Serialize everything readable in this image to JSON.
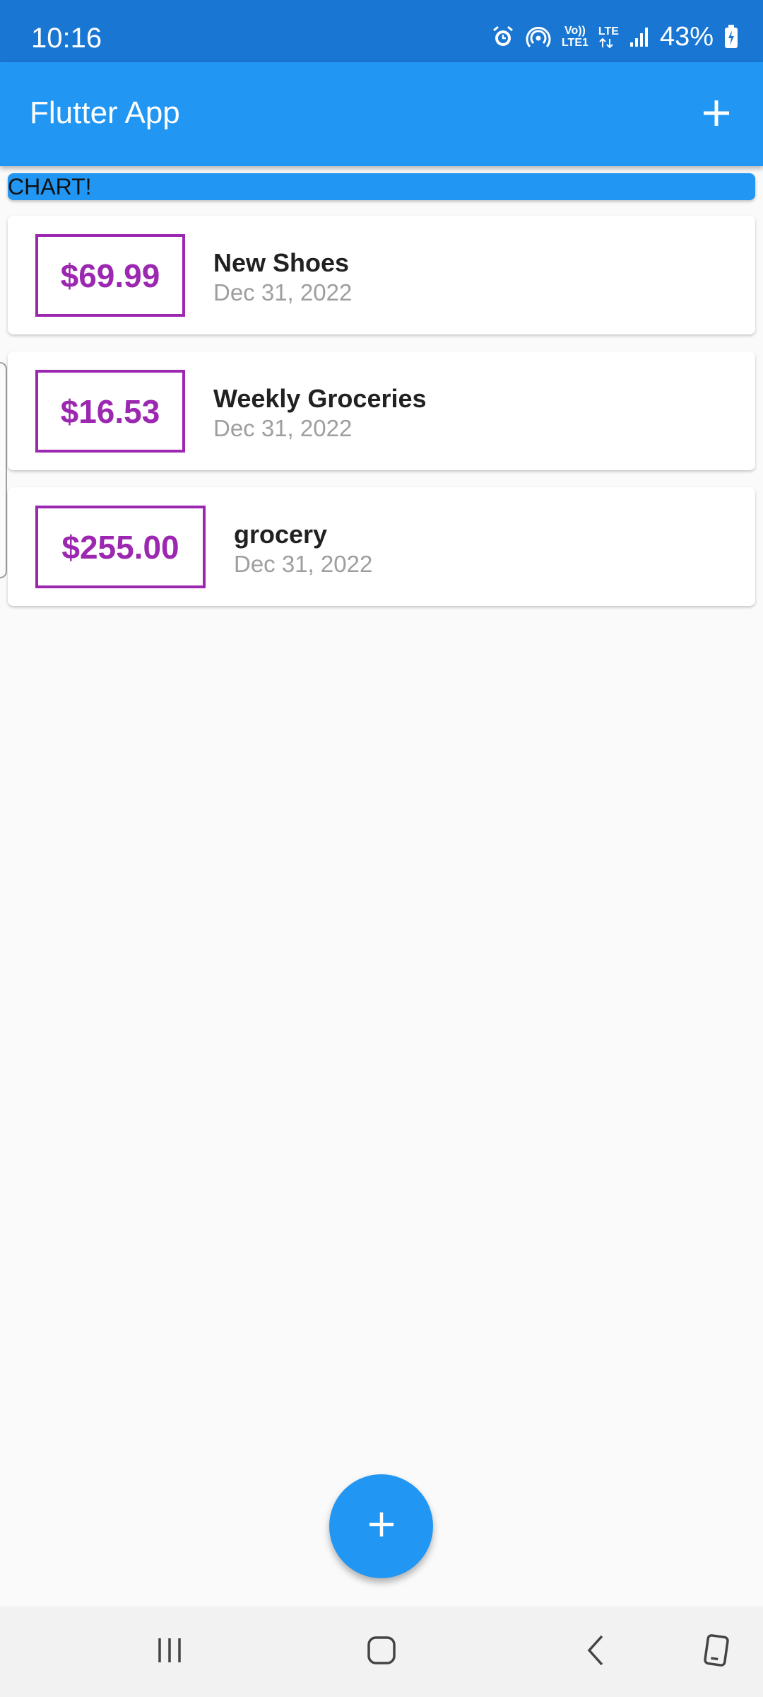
{
  "status_bar": {
    "time": "10:16",
    "network_top": "Vo))",
    "network_bottom": "LTE1",
    "lte_label": "LTE",
    "battery": "43%",
    "icons": [
      "alarm-icon",
      "hotspot-icon",
      "volte-icon",
      "lte-icon",
      "signal-icon",
      "battery-icon"
    ]
  },
  "app_bar": {
    "title": "Flutter App",
    "action_icon": "add-icon"
  },
  "chart": {
    "label": "CHART!"
  },
  "transactions": [
    {
      "amount": "$69.99",
      "title": "New Shoes",
      "date": "Dec 31, 2022"
    },
    {
      "amount": "$16.53",
      "title": "Weekly Groceries",
      "date": "Dec 31, 2022"
    },
    {
      "amount": "$255.00",
      "title": "grocery",
      "date": "Dec 31, 2022"
    }
  ],
  "fab": {
    "icon": "add-icon"
  },
  "nav_bar": {
    "icons": [
      "recent-apps-icon",
      "home-icon",
      "back-icon",
      "rotate-screen-icon"
    ]
  },
  "colors": {
    "primary": "#2196f3",
    "status_bar": "#1976d2",
    "amount_accent": "#9c27b0",
    "date_text": "#9e9e9e"
  }
}
